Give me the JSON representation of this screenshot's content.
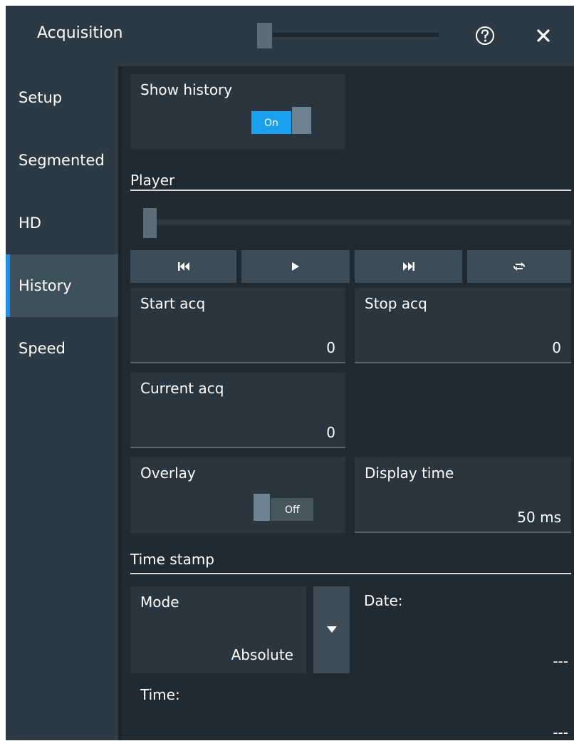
{
  "window": {
    "title": "Acquisition"
  },
  "sidebar": {
    "items": [
      {
        "label": "Setup",
        "active": false
      },
      {
        "label": "Segmented",
        "active": false
      },
      {
        "label": "HD",
        "active": false
      },
      {
        "label": "History",
        "active": true
      },
      {
        "label": "Speed",
        "active": false
      }
    ]
  },
  "show_history": {
    "label": "Show history",
    "state": "On"
  },
  "player": {
    "section_label": "Player",
    "position": 0,
    "buttons": [
      "skip-to-start",
      "play",
      "skip-to-end",
      "repeat"
    ]
  },
  "start_acq": {
    "label": "Start acq",
    "value": "0"
  },
  "stop_acq": {
    "label": "Stop acq",
    "value": "0"
  },
  "current_acq": {
    "label": "Current acq",
    "value": "0"
  },
  "overlay": {
    "label": "Overlay",
    "state": "Off"
  },
  "display_time": {
    "label": "Display time",
    "value": "50 ms"
  },
  "time_stamp": {
    "section_label": "Time stamp",
    "mode_label": "Mode",
    "mode_value": "Absolute",
    "date_label": "Date:",
    "date_value": "---",
    "time_label": "Time:",
    "time_value": "---"
  },
  "colors": {
    "accent": "#1aa0f0",
    "panel": "#2a363f",
    "background": "#1f2a33"
  }
}
